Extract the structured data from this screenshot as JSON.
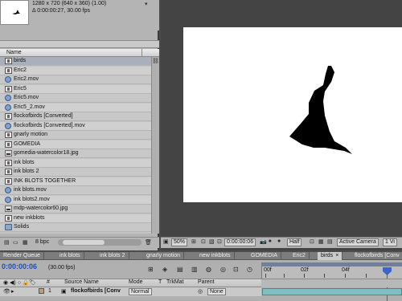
{
  "project": {
    "footage_info": {
      "resolution": "1280 x 720  (640 x 360) (1.00)",
      "duration": "Δ 0:00:00:27, 30.00 fps"
    },
    "column_name": "Name",
    "items": [
      {
        "label": "birds",
        "type": "comp",
        "selected": true
      },
      {
        "label": "Eric2",
        "type": "comp"
      },
      {
        "label": "Eric2.mov",
        "type": "movie"
      },
      {
        "label": "Eric5",
        "type": "comp"
      },
      {
        "label": "Eric5.mov",
        "type": "movie"
      },
      {
        "label": "Eric5_2.mov",
        "type": "movie"
      },
      {
        "label": "flockofbirds [Converted]",
        "type": "comp"
      },
      {
        "label": "flockofbirds [Converted].mov",
        "type": "movie"
      },
      {
        "label": "gnarly motion",
        "type": "comp"
      },
      {
        "label": "GOMEDIA",
        "type": "comp"
      },
      {
        "label": "gomedia-watercolor18.jpg",
        "type": "image"
      },
      {
        "label": "ink blots",
        "type": "comp"
      },
      {
        "label": "ink blots 2",
        "type": "comp"
      },
      {
        "label": "INK BLOTS TOGETHER",
        "type": "comp"
      },
      {
        "label": "ink blots.mov",
        "type": "movie"
      },
      {
        "label": "ink blots2.mov",
        "type": "movie"
      },
      {
        "label": "mdp-watercolor60.jpg",
        "type": "image"
      },
      {
        "label": "new inkblots",
        "type": "comp"
      },
      {
        "label": "Solids",
        "type": "folder"
      }
    ],
    "bpc": "8 bpc"
  },
  "viewer": {
    "zoom": "50%",
    "timecode": "0:00:00:06",
    "resolution": "Half",
    "camera": "Active Camera",
    "views": "1 Vi"
  },
  "tabs": [
    {
      "label": "Render Queue"
    },
    {
      "label": "ink blots"
    },
    {
      "label": "ink blots 2"
    },
    {
      "label": "gnarly motion"
    },
    {
      "label": "new inkblots"
    },
    {
      "label": "GOMEDIA"
    },
    {
      "label": "Eric2"
    },
    {
      "label": "birds",
      "active": true,
      "close": "×"
    },
    {
      "label": "flockofbirds [Conv"
    }
  ],
  "timeline": {
    "timecode": "0:00:00:06",
    "fps": "(30.00 fps)",
    "columns": {
      "hash": "#",
      "source_name": "Source Name",
      "mode": "Mode",
      "t": "T",
      "trkmat": "TrkMat",
      "parent": "Parent"
    },
    "ruler": [
      "00f",
      "02f",
      "04f"
    ],
    "layer": {
      "index": "1",
      "name": "flockofbirds [Conv",
      "mode": "Normal",
      "parent": "None"
    }
  }
}
